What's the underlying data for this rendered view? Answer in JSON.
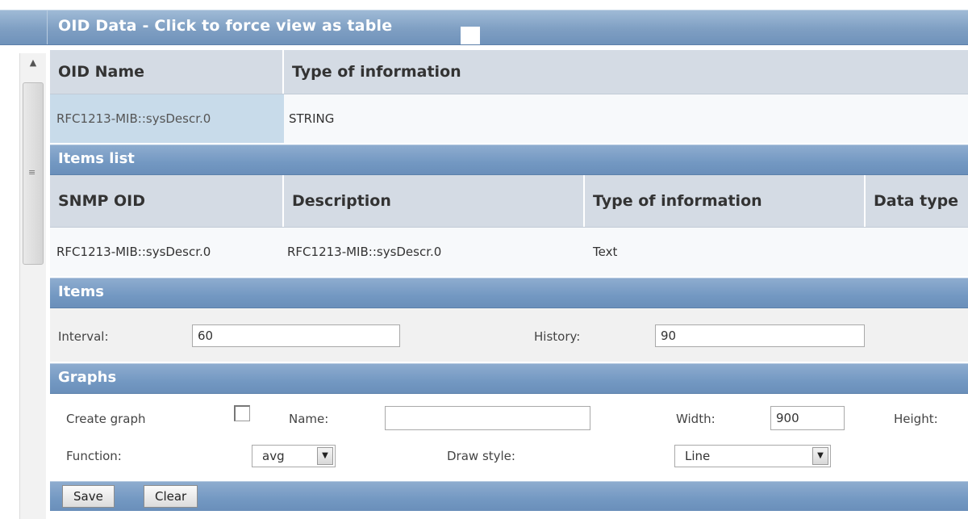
{
  "header": {
    "title": "OID Data - Click to force view as table"
  },
  "oid_table": {
    "columns": [
      "OID Name",
      "Type of information"
    ],
    "rows": [
      [
        "RFC1213-MIB::sysDescr.0",
        "STRING"
      ]
    ]
  },
  "items_list": {
    "title": "Items list",
    "columns": [
      "SNMP OID",
      "Description",
      "Type of information",
      "Data type"
    ],
    "rows": [
      [
        "RFC1213-MIB::sysDescr.0",
        "RFC1213-MIB::sysDescr.0",
        "Text",
        ""
      ]
    ]
  },
  "items": {
    "title": "Items",
    "interval_label": "Interval:",
    "interval_value": "60",
    "history_label": "History:",
    "history_value": "90"
  },
  "graphs": {
    "title": "Graphs",
    "create_graph_label": "Create graph",
    "name_label": "Name:",
    "name_value": "",
    "width_label": "Width:",
    "width_value": "900",
    "height_label": "Height:",
    "function_label": "Function:",
    "function_value": "avg",
    "draw_style_label": "Draw style:",
    "draw_style_value": "Line"
  },
  "buttons": {
    "save": "Save",
    "clear": "Clear"
  },
  "colors": {
    "header_blue": "#7f9fc3",
    "column_header_bg": "#d4dbe4",
    "selected_cell_bg": "#c8dbea"
  }
}
